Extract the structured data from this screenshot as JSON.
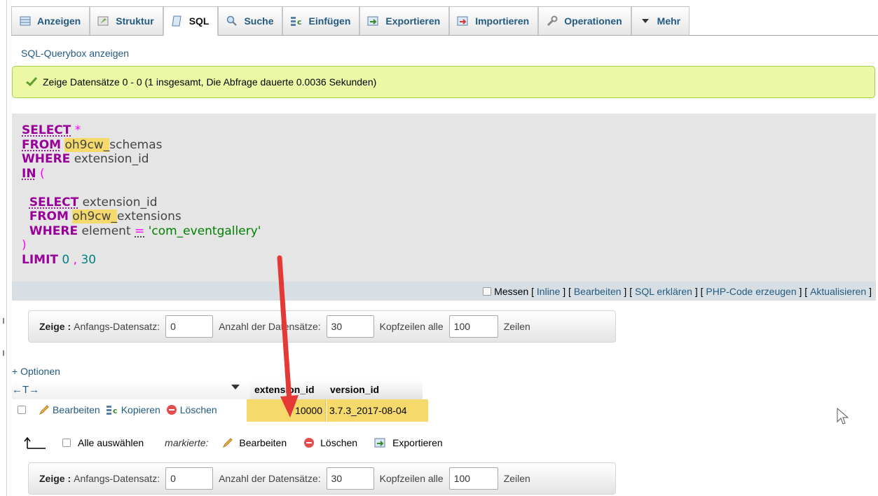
{
  "tabs": [
    {
      "label": "Anzeigen",
      "icon": "browse-icon"
    },
    {
      "label": "Struktur",
      "icon": "structure-icon"
    },
    {
      "label": "SQL",
      "icon": "sql-icon",
      "active": true
    },
    {
      "label": "Suche",
      "icon": "search-icon"
    },
    {
      "label": "Einfügen",
      "icon": "insert-icon"
    },
    {
      "label": "Exportieren",
      "icon": "export-icon"
    },
    {
      "label": "Importieren",
      "icon": "import-icon"
    },
    {
      "label": "Operationen",
      "icon": "wrench-icon"
    },
    {
      "label": "Mehr",
      "icon": "caret-down-icon"
    }
  ],
  "querybox_link": "SQL-Querybox anzeigen",
  "success_message": "Zeige Datensätze 0 - 0 (1 insgesamt, Die Abfrage dauerte 0.0036 Sekunden)",
  "sql": {
    "l1_kw": "SELECT",
    "l1_rest": "*",
    "l2_kw": "FROM",
    "l2_prefix": "oh9cw_",
    "l2_rest": "schemas",
    "l3_kw": "WHERE",
    "l3_rest": "extension_id",
    "l4_kw": "IN",
    "l4_rest": "(",
    "l6_kw": "SELECT",
    "l6_rest": "extension_id",
    "l7_kw": "FROM",
    "l7_prefix": "oh9cw_",
    "l7_rest": "extensions",
    "l8_kw": "WHERE",
    "l8_field": "element",
    "l8_op": "=",
    "l8_str": "'com_eventgallery'",
    "l9": ")",
    "l10_kw": "LIMIT",
    "l10_a": "0",
    "l10_sep": ",",
    "l10_b": "30"
  },
  "sql_footer": {
    "measure_label": "Messen",
    "links": [
      "Inline",
      "Bearbeiten",
      "SQL erklären",
      "PHP-Code erzeugen",
      "Aktualisieren"
    ]
  },
  "navigation": {
    "show_label": "Zeige :",
    "start_label": "Anfangs-Datensatz:",
    "start_value": "0",
    "count_label": "Anzahl der Datensätze:",
    "count_value": "30",
    "headers_label": "Kopfzeilen alle",
    "headers_value": "100",
    "rows_label": "Zeilen"
  },
  "options_link": "+ Optionen",
  "column_nav": "←T→",
  "columns": [
    "extension_id",
    "version_id"
  ],
  "row": {
    "edit": "Bearbeiten",
    "copy": "Kopieren",
    "delete": "Löschen",
    "extension_id": "10000",
    "version_id": "3.7.3_2017-08-04"
  },
  "bulk": {
    "select_all": "Alle auswählen",
    "marked": "markierte:",
    "edit": "Bearbeiten",
    "delete": "Löschen",
    "export": "Exportieren"
  },
  "colors": {
    "link": "#235a81",
    "keyword": "#990099",
    "highlight": "#f5d96b",
    "success_bg": "#ebf8a4",
    "annotation_arrow": "#e53935"
  }
}
